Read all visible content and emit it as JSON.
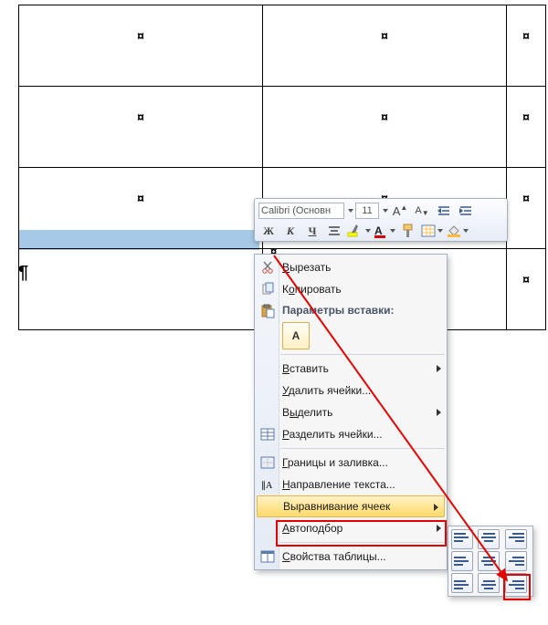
{
  "table": {
    "cell_marker": "¤"
  },
  "pilcrow": "¶",
  "mini_toolbar": {
    "font_name": "Calibri (Основн",
    "font_size": "11"
  },
  "context_menu": {
    "cut": "Вырезать",
    "copy": "Копировать",
    "paste_options_header": "Параметры вставки:",
    "paste_option_a": "A",
    "insert": "Вставить",
    "delete_cells": "Удалить ячейки...",
    "select": "Выделить",
    "split_cells": "Разделить ячейки...",
    "borders_shading": "Границы и заливка...",
    "text_direction": "Направление текста...",
    "cell_alignment": "Выравнивание ячеек",
    "autofit": "Автоподбор",
    "table_properties": "Свойства таблицы..."
  }
}
